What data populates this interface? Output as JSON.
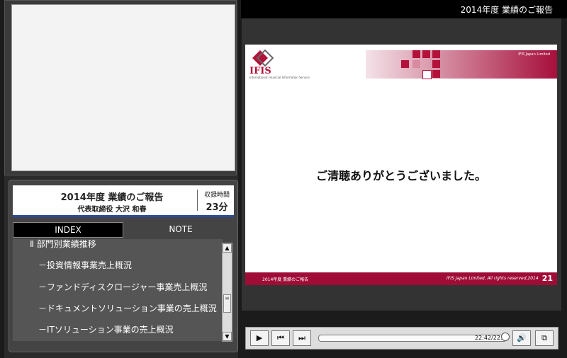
{
  "window": {
    "title": "2014年度 業績のご報告"
  },
  "talk": {
    "title": "2014年度 業績のご報告",
    "speaker": "代表取締役 大沢 和春",
    "duration_label": "収録時間",
    "duration_value": "23分"
  },
  "tabs": [
    {
      "label": "INDEX"
    },
    {
      "label": "NOTE"
    }
  ],
  "index": {
    "items": [
      "Ⅱ 部門別業績推移",
      "－投資情報事業売上概況",
      "－ファンドディスクロージャー事業売上概況",
      "－ドキュメントソリューション事業の売上概況",
      "－ITソリューション事業の売上概況"
    ]
  },
  "slide": {
    "logo": "IFIS",
    "logo_sub": "International Financial Information Service",
    "header_small": "IFIS Japan Limited",
    "body": "ご清聴ありがとうございました。",
    "footer_left": "2014年度 業績のご報告",
    "footer_right": "IFIS Japan Limited, All rights reserved,2014",
    "page_number": "21"
  },
  "player": {
    "play": "▶",
    "prev": "⏮",
    "next": "⏭",
    "time": "22:42/22:4",
    "volume": "🔊",
    "popout": "⧉",
    "progress": 0.98
  },
  "icons": {
    "scroll_up": "▲",
    "scroll_down": "▼"
  },
  "colors": {
    "brand": "#b3123a"
  }
}
